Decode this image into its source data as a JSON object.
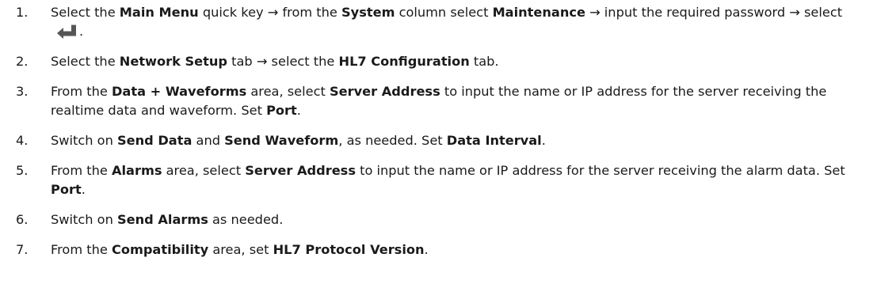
{
  "steps": [
    {
      "number": "1.",
      "parts": [
        "Select the ",
        "Main Menu",
        " quick key → from the ",
        "System",
        " column select ",
        "Maintenance",
        " → input the required password → select ",
        "."
      ],
      "icon": "enter-key-icon"
    },
    {
      "number": "2.",
      "parts": [
        "Select the ",
        "Network Setup",
        " tab → select the ",
        "HL7 Configuration",
        " tab."
      ]
    },
    {
      "number": "3.",
      "parts": [
        "From the ",
        "Data + Waveforms",
        " area, select ",
        "Server Address",
        " to input the name or IP address for the server receiving the realtime data and waveform. Set ",
        "Port",
        "."
      ]
    },
    {
      "number": "4.",
      "parts": [
        "Switch on ",
        "Send Data",
        " and ",
        "Send Waveform",
        ", as needed. Set ",
        "Data Interval",
        "."
      ]
    },
    {
      "number": "5.",
      "parts": [
        "From the ",
        "Alarms",
        " area, select ",
        "Server Address",
        " to input the name or IP address for the server receiving the alarm data. Set ",
        "Port",
        "."
      ]
    },
    {
      "number": "6.",
      "parts": [
        "Switch on ",
        "Send Alarms",
        " as needed."
      ]
    },
    {
      "number": "7.",
      "parts": [
        "From the ",
        "Compatibility",
        " area, set ",
        "HL7 Protocol Version",
        "."
      ]
    }
  ],
  "colors": {
    "text": "#1a1a1a",
    "icon": "#555555"
  }
}
